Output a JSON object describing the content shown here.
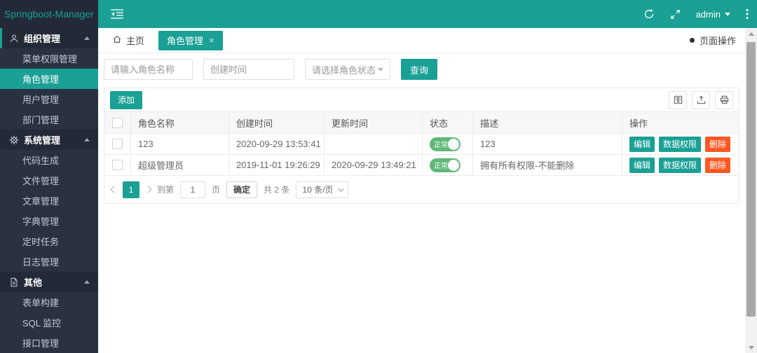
{
  "colors": {
    "accent": "#1aa094",
    "sidebar_bg": "#2a3140",
    "switch_on": "#5FB878",
    "danger": "#ff5722"
  },
  "sidebar": {
    "logo": "Springboot-Manager",
    "items": [
      {
        "type": "section",
        "icon": "user-icon",
        "label": "组织管理"
      },
      {
        "type": "item",
        "label": "菜单权限管理"
      },
      {
        "type": "item",
        "label": "角色管理",
        "active": true
      },
      {
        "type": "item",
        "label": "用户管理"
      },
      {
        "type": "item",
        "label": "部门管理"
      },
      {
        "type": "section",
        "icon": "gear-icon",
        "label": "系统管理"
      },
      {
        "type": "item",
        "label": "代码生成"
      },
      {
        "type": "item",
        "label": "文件管理"
      },
      {
        "type": "item",
        "label": "文章管理"
      },
      {
        "type": "item",
        "label": "字典管理"
      },
      {
        "type": "item",
        "label": "定时任务"
      },
      {
        "type": "item",
        "label": "日志管理"
      },
      {
        "type": "section",
        "icon": "file-icon",
        "label": "其他"
      },
      {
        "type": "item",
        "label": "表单构建"
      },
      {
        "type": "item",
        "label": "SQL 监控"
      },
      {
        "type": "item",
        "label": "接口管理"
      }
    ]
  },
  "topbar": {
    "username": "admin"
  },
  "tabbar": {
    "home_tab": "主页",
    "active_tab": "角色管理",
    "page_ops": "页面操作"
  },
  "search": {
    "name_placeholder": "请输入角色名称",
    "date_placeholder": "创建时间",
    "status_placeholder": "请选择角色状态",
    "search_button": "查询"
  },
  "table": {
    "add_button": "添加",
    "headers": [
      "角色名称",
      "创建时间",
      "更新时间",
      "状态",
      "描述",
      "操作"
    ],
    "rows": [
      {
        "name": "123",
        "created": "2020-09-29 13:53:41",
        "updated": "",
        "status": "正常",
        "description": "123"
      },
      {
        "name": "超级管理员",
        "created": "2019-11-01 19:26:29",
        "updated": "2020-09-29 13:49:21",
        "status": "正常",
        "description": "拥有所有权限-不能删除"
      }
    ],
    "row_actions": {
      "edit": "编辑",
      "data_perm": "数据权限",
      "delete": "删除"
    }
  },
  "pagination": {
    "current_page": "1",
    "goto_label": "到第",
    "goto_value": "1",
    "page_unit": "页",
    "confirm_button": "确定",
    "total_text": "共 2 条",
    "page_size": "10 条/页"
  }
}
